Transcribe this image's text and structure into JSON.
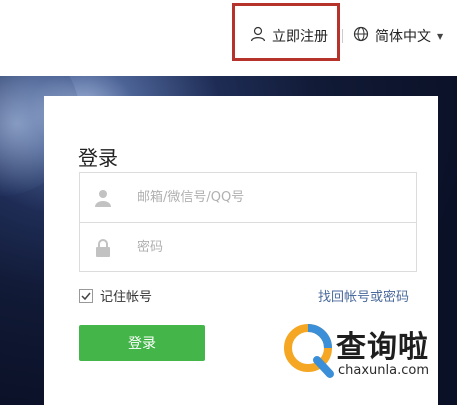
{
  "header": {
    "register_label": "立即注册",
    "language_label": "简体中文"
  },
  "login": {
    "title": "登录",
    "username_placeholder": "邮箱/微信号/QQ号",
    "password_placeholder": "密码",
    "remember_label": "记住帐号",
    "remember_checked": true,
    "forgot_label": "找回帐号或密码",
    "submit_label": "登录"
  },
  "watermark": {
    "text": "查询啦",
    "url": "chaxunla.com"
  },
  "colors": {
    "accent_green": "#44b549",
    "highlight_box": "#b5332b",
    "link_blue": "#4a6a9c"
  }
}
